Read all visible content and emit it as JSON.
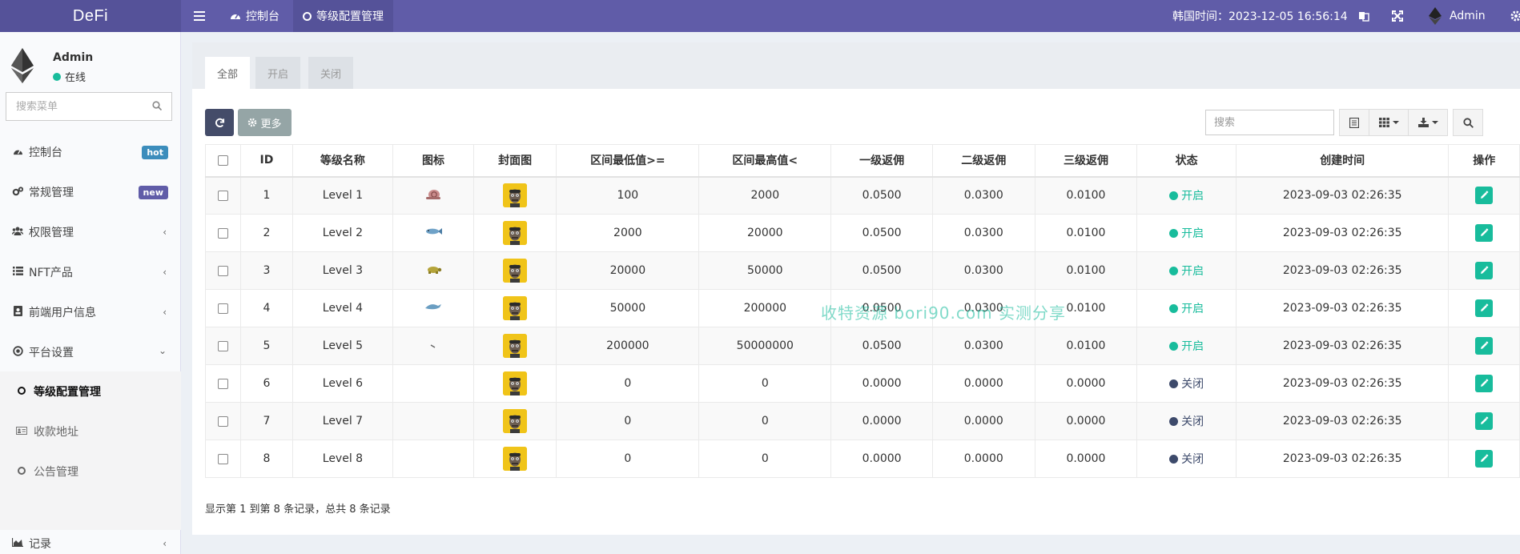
{
  "app": {
    "brand": "DeFi"
  },
  "topbar": {
    "tabs": [
      {
        "label": "控制台",
        "icon": "dashboard-icon"
      },
      {
        "label": "等级配置管理",
        "icon": "ring-icon"
      }
    ],
    "time_label": "韩国时间：2023-12-05 16:56:14",
    "user": "Admin"
  },
  "sidebar": {
    "user": {
      "name": "Admin",
      "status": "在线"
    },
    "search_placeholder": "搜索菜单",
    "items": [
      {
        "label": "控制台",
        "icon": "dashboard-icon",
        "badge": "hot",
        "badge_color": "#3c8dbc"
      },
      {
        "label": "常规管理",
        "icon": "cogs-icon",
        "badge": "new",
        "badge_color": "#605ca8"
      },
      {
        "label": "权限管理",
        "icon": "group-icon"
      },
      {
        "label": "NFT产品",
        "icon": "list-icon"
      },
      {
        "label": "前端用户信息",
        "icon": "address-book-icon"
      },
      {
        "label": "平台设置",
        "icon": "dot-circle-icon"
      },
      {
        "label": "记录",
        "icon": "area-chart-icon"
      }
    ],
    "sub_items": [
      {
        "label": "等级配置管理",
        "icon": "ring-icon"
      },
      {
        "label": "收款地址",
        "icon": "id-card-icon"
      },
      {
        "label": "公告管理",
        "icon": "ring-icon"
      }
    ]
  },
  "content": {
    "tabs": [
      "全部",
      "开启",
      "关闭"
    ],
    "more_label": "更多",
    "search_placeholder": "搜索",
    "columns": [
      "ID",
      "等级名称",
      "图标",
      "封面图",
      "区间最低值>=",
      "区间最高值<",
      "一级返佣",
      "二级返佣",
      "三级返佣",
      "状态",
      "创建时间",
      "操作"
    ],
    "rows": [
      {
        "id": "1",
        "name": "Level 1",
        "icon": "snail",
        "min": "100",
        "max": "2000",
        "r1": "0.0500",
        "r2": "0.0300",
        "r3": "0.0100",
        "status": "开启",
        "status_color": "#18bc9c",
        "created": "2023-09-03 02:26:35"
      },
      {
        "id": "2",
        "name": "Level 2",
        "icon": "fish",
        "min": "2000",
        "max": "20000",
        "r1": "0.0500",
        "r2": "0.0300",
        "r3": "0.0100",
        "status": "开启",
        "status_color": "#18bc9c",
        "created": "2023-09-03 02:26:35"
      },
      {
        "id": "3",
        "name": "Level 3",
        "icon": "turtle",
        "min": "20000",
        "max": "50000",
        "r1": "0.0500",
        "r2": "0.0300",
        "r3": "0.0100",
        "status": "开启",
        "status_color": "#18bc9c",
        "created": "2023-09-03 02:26:35"
      },
      {
        "id": "4",
        "name": "Level 4",
        "icon": "dolphin",
        "min": "50000",
        "max": "200000",
        "r1": "0.0500",
        "r2": "0.0300",
        "r3": "0.0100",
        "status": "开启",
        "status_color": "#18bc9c",
        "created": "2023-09-03 02:26:35"
      },
      {
        "id": "5",
        "name": "Level 5",
        "icon": "tiny",
        "min": "200000",
        "max": "50000000",
        "r1": "0.0500",
        "r2": "0.0300",
        "r3": "0.0100",
        "status": "开启",
        "status_color": "#18bc9c",
        "created": "2023-09-03 02:26:35"
      },
      {
        "id": "6",
        "name": "Level 6",
        "icon": "",
        "min": "0",
        "max": "0",
        "r1": "0.0000",
        "r2": "0.0000",
        "r3": "0.0000",
        "status": "关闭",
        "status_color": "#3d4a6b",
        "created": "2023-09-03 02:26:35"
      },
      {
        "id": "7",
        "name": "Level 7",
        "icon": "",
        "min": "0",
        "max": "0",
        "r1": "0.0000",
        "r2": "0.0000",
        "r3": "0.0000",
        "status": "关闭",
        "status_color": "#3d4a6b",
        "created": "2023-09-03 02:26:35"
      },
      {
        "id": "8",
        "name": "Level 8",
        "icon": "",
        "min": "0",
        "max": "0",
        "r1": "0.0000",
        "r2": "0.0000",
        "r3": "0.0000",
        "status": "关闭",
        "status_color": "#3d4a6b",
        "created": "2023-09-03 02:26:35"
      }
    ],
    "summary": "显示第 1 到第 8 条记录，总共 8 条记录",
    "watermark": "收特资源 bori90.com 实测分享"
  },
  "colors": {
    "header": "#605ca8",
    "accent": "#18bc9c",
    "primary_btn": "#444c69",
    "more_btn": "#95a5a6"
  }
}
